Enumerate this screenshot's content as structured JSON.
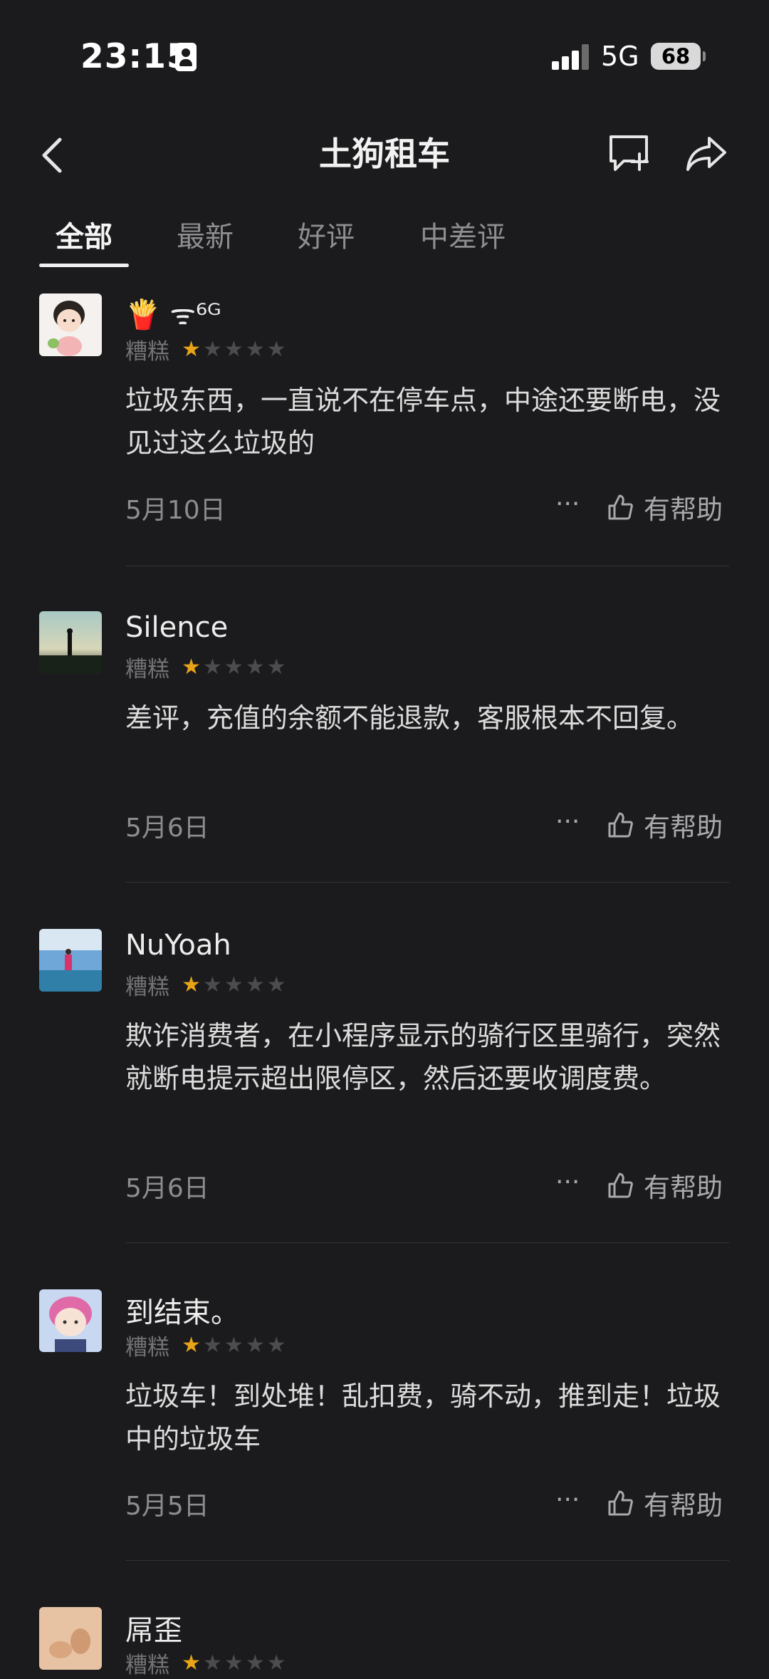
{
  "status_bar": {
    "time": "23:15",
    "network": "5G",
    "battery": "68"
  },
  "nav": {
    "title": "土狗租车"
  },
  "tabs": [
    {
      "label": "全部",
      "active": true
    },
    {
      "label": "最新",
      "active": false
    },
    {
      "label": "好评",
      "active": false
    },
    {
      "label": "中差评",
      "active": false
    }
  ],
  "reviews": [
    {
      "user": "🍟 ᯤ⁶ᴳ",
      "rating_label": "糟糕",
      "rating": 1,
      "text": "垃圾东西，一直说不在停车点，中途还要断电，没见过这么垃圾的",
      "date": "5月10日",
      "helpful_label": "有帮助"
    },
    {
      "user": "Silence",
      "rating_label": "糟糕",
      "rating": 1,
      "text": "差评，充值的余额不能退款，客服根本不回复。",
      "date": "5月6日",
      "helpful_label": "有帮助"
    },
    {
      "user": "NuYoah",
      "rating_label": "糟糕",
      "rating": 1,
      "text": "欺诈消费者，在小程序显示的骑行区里骑行，突然就断电提示超出限停区，然后还要收调度费。",
      "date": "5月6日",
      "helpful_label": "有帮助"
    },
    {
      "user": "到结束。",
      "rating_label": "糟糕",
      "rating": 1,
      "text": "垃圾车！到处堆！乱扣费，骑不动，推到走！垃圾中的垃圾车",
      "date": "5月5日",
      "helpful_label": "有帮助"
    },
    {
      "user": "屌歪",
      "rating_label": "糟糕",
      "rating": 1,
      "text": "",
      "date": "",
      "helpful_label": ""
    }
  ],
  "colors": {
    "background": "#1b1b1d",
    "star_on": "#e8a417",
    "star_off": "#4c4c4f"
  }
}
